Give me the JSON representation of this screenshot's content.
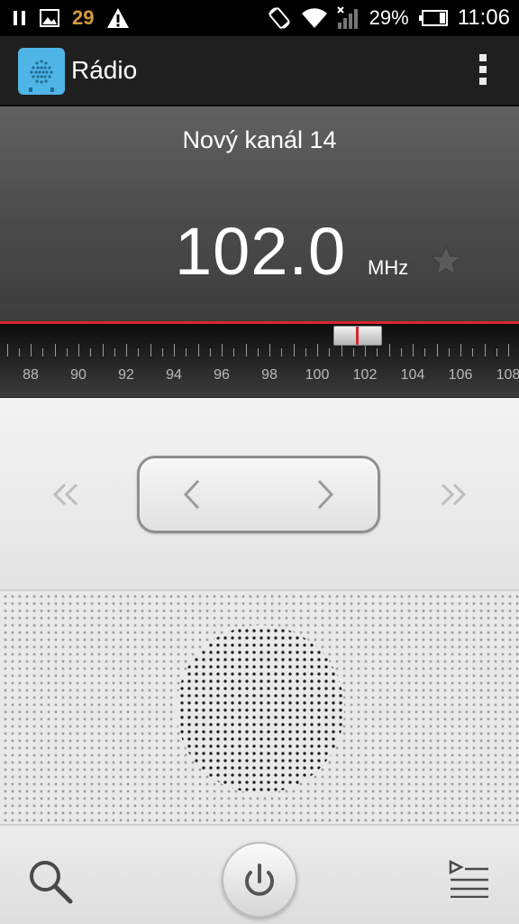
{
  "status_bar": {
    "notification_count": "29",
    "battery_percent": "29%",
    "time": "11:06",
    "icons": [
      "pause-icon",
      "image-icon",
      "warning-icon",
      "rotation-lock-icon",
      "wifi-icon",
      "signal-icon",
      "battery-icon"
    ]
  },
  "action_bar": {
    "title": "Rádio",
    "icons": [
      "radio-app-icon",
      "overflow-menu-icon"
    ]
  },
  "tuner": {
    "station_name": "Nový kanál 14",
    "frequency": "102.0",
    "unit": "MHz",
    "favorite": false,
    "current_frequency_mhz": 102.0,
    "scale_min_mhz": 87,
    "scale_max_mhz": 108,
    "scale_labels": [
      "88",
      "90",
      "92",
      "94",
      "96",
      "98",
      "100",
      "102",
      "104",
      "106",
      "108"
    ]
  },
  "controls": {
    "icons": [
      "seek-back-icon",
      "step-back-icon",
      "step-forward-icon",
      "seek-forward-icon"
    ]
  },
  "bottom_bar": {
    "icons": [
      "search-icon",
      "power-icon",
      "playlist-icon"
    ]
  },
  "colors": {
    "accent_red": "#d8262c",
    "app_icon_blue": "#4fb4e6",
    "notification_orange": "#d89a3c"
  }
}
